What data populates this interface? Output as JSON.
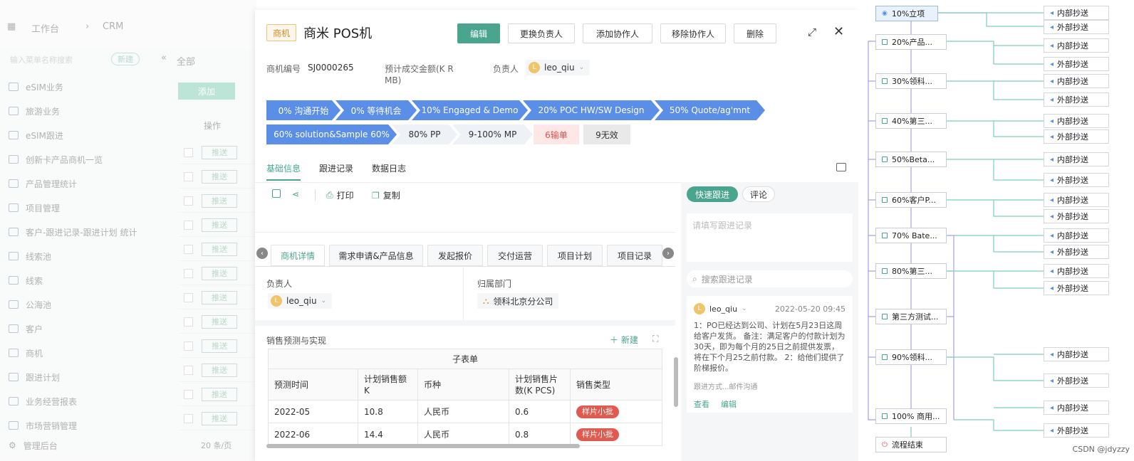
{
  "background": {
    "breadcrumb": [
      "工作台",
      "CRM"
    ],
    "search_placeholder": "输入菜单名称搜索",
    "new_label": "新建",
    "all_label": "全部",
    "add_label": "添加",
    "op_header": "操作",
    "push_label": "推送",
    "menu": [
      "eSIM业务",
      "旅游业务",
      "eSIM跟进",
      "创新卡产品商机一览",
      "产品管理统计",
      "项目管理",
      "客户-跟进记录-跟进计划 统计",
      "线索池",
      "线索",
      "公海池",
      "客户",
      "商机",
      "跟进计划",
      "业务经营报表",
      "市场营销管理"
    ],
    "admin_label": "管理后台",
    "page_size": "20 条/页"
  },
  "modal": {
    "type_badge": "商机",
    "title": "商米 POS机",
    "buttons": {
      "edit": "编辑",
      "change_owner": "更换负责人",
      "add_collab": "添加协作人",
      "remove_collab": "移除协作人",
      "delete": "删除"
    },
    "meta": {
      "code_label": "商机编号",
      "code_value": "SJ0000265",
      "amount_label_1": "预计成交金额(K R",
      "amount_label_2": "MB)",
      "owner_label": "负责人",
      "owner_avatar": "L",
      "owner_name": "leo_qiu"
    },
    "stages_row1": [
      "0% 沟通开始",
      "0% 等待机会",
      "10% Engaged & Demo",
      "20% POC HW/SW Design",
      "50% Quote/ag'mnt"
    ],
    "stages_row2": {
      "done": "60% solution&Sample 60%",
      "pp": "80% PP",
      "mp": "9-100% MP",
      "lost": "6输单",
      "invalid": "9无效"
    },
    "tabs": [
      "基础信息",
      "跟进记录",
      "数据日志"
    ],
    "toolbar": {
      "print": "打印",
      "copy": "复制"
    },
    "subtabs": [
      "商机详情",
      "需求申请&产品信息",
      "发起报价",
      "交付运营",
      "项目计划",
      "项目记录"
    ],
    "fields": {
      "owner_label": "负责人",
      "owner_avatar": "L",
      "owner_name": "leo_qiu",
      "dept_label": "归属部门",
      "dept_name": "领科北京分公司"
    },
    "sales": {
      "section_title": "销售预测与实现",
      "new_label": "新建",
      "table_caption": "子表单",
      "headers": [
        "预测时间",
        "计划销售额 K",
        "币种",
        "计划销售片数(K PCS)",
        "销售类型"
      ],
      "rows": [
        [
          "2022-05",
          "10.8",
          "人民币",
          "0.6",
          "样片小批"
        ],
        [
          "2022-06",
          "14.4",
          "人民币",
          "0.8",
          "样片小批"
        ]
      ]
    },
    "follow": {
      "quick_label": "快速跟进",
      "comment_label": "评论",
      "textarea_placeholder": "请填写跟进记录",
      "search_placeholder": "搜索跟进记录",
      "record": {
        "avatar": "L",
        "user": "leo_qiu",
        "time": "2022-05-20 09:45",
        "content": "1：PO已经达到公司、计划在5月23日这周给客户发货。 备注：满足客户的付款计划为30天，即为每个月的25日之前提供发票，将在下个月25之前付款。 2：给他们提供了阶梯报价。",
        "method": "跟进方式...邮件沟通",
        "view_label": "查看",
        "edit_label": "编辑"
      }
    }
  },
  "flow": {
    "nodes": [
      "10%立项",
      "20%产品...",
      "30%领科...",
      "40%第三...",
      "50%Beta...",
      "60%客户P...",
      "70% Bate...",
      "80%第三...",
      "第三方测试...",
      "90%领科...",
      "100% 商用...",
      "流程结束"
    ],
    "cc_internal": "内部抄送",
    "cc_external": "外部抄送",
    "watermark": "CSDN @jdyzzy"
  }
}
